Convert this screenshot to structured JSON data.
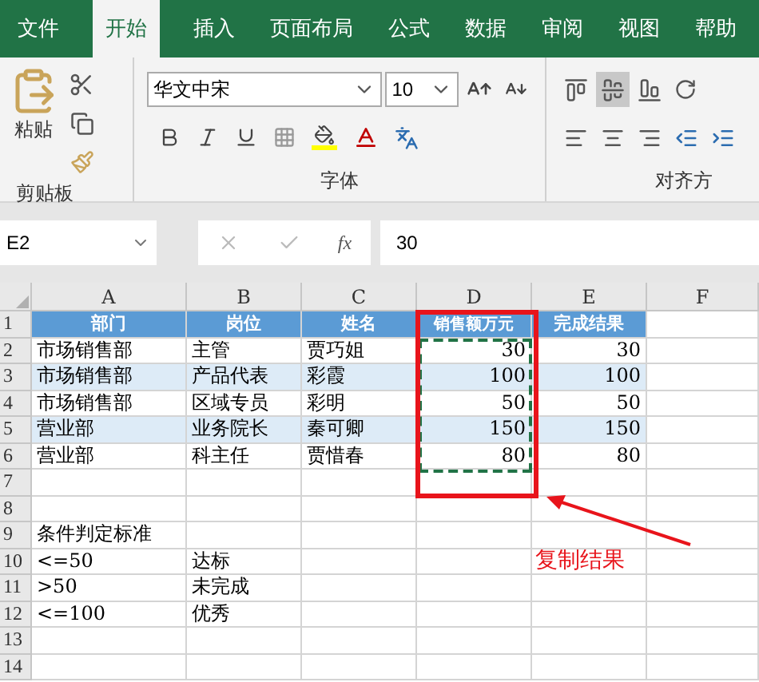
{
  "menu_tabs": [
    {
      "label": "文件",
      "selected": false
    },
    {
      "label": "开始",
      "selected": true
    },
    {
      "label": "插入",
      "selected": false
    },
    {
      "label": "页面布局",
      "selected": false
    },
    {
      "label": "公式",
      "selected": false
    },
    {
      "label": "数据",
      "selected": false
    },
    {
      "label": "审阅",
      "selected": false
    },
    {
      "label": "视图",
      "selected": false
    },
    {
      "label": "帮助",
      "selected": false
    }
  ],
  "ribbon": {
    "clipboard": {
      "paste_label": "粘贴",
      "group_label": "剪贴板"
    },
    "font": {
      "font_name": "华文中宋",
      "font_size": "10",
      "group_label": "字体"
    },
    "alignment": {
      "group_label": "对齐方",
      "vertical_align": [
        {
          "selected": false
        },
        {
          "selected": true
        },
        {
          "selected": false
        }
      ]
    }
  },
  "formula_bar": {
    "name_box": "E2",
    "fx_label": "fx",
    "value": "30"
  },
  "sheet": {
    "columns": [
      "A",
      "B",
      "C",
      "D",
      "E",
      "F"
    ],
    "rows": [
      {
        "number": "1",
        "kind": "header",
        "cells": {
          "A": "部门",
          "B": "岗位",
          "C": "姓名",
          "D": "销售额万元",
          "E": "完成结果"
        }
      },
      {
        "number": "2",
        "kind": "plain",
        "cells": {
          "A": "市场销售部",
          "B": "主管",
          "C": "贾巧姐",
          "D": "30",
          "E": "30"
        }
      },
      {
        "number": "3",
        "kind": "band",
        "cells": {
          "A": "市场销售部",
          "B": "产品代表",
          "C": "彩霞",
          "D": "100",
          "E": "100"
        }
      },
      {
        "number": "4",
        "kind": "plain",
        "cells": {
          "A": "市场销售部",
          "B": "区域专员",
          "C": "彩明",
          "D": "50",
          "E": "50"
        }
      },
      {
        "number": "5",
        "kind": "band",
        "cells": {
          "A": "营业部",
          "B": "业务院长",
          "C": "秦可卿",
          "D": "150",
          "E": "150"
        }
      },
      {
        "number": "6",
        "kind": "plain",
        "cells": {
          "A": "营业部",
          "B": "科主任",
          "C": "贾惜春",
          "D": "80",
          "E": "80"
        }
      },
      {
        "number": "7",
        "kind": "empty",
        "cells": {}
      },
      {
        "number": "8",
        "kind": "empty",
        "cells": {}
      },
      {
        "number": "9",
        "kind": "empty",
        "cells": {
          "A": "条件判定标准"
        }
      },
      {
        "number": "10",
        "kind": "empty",
        "cells": {
          "A": "<=50",
          "B": "达标"
        }
      },
      {
        "number": "11",
        "kind": "empty",
        "cells": {
          "A": ">50",
          "B": "未完成"
        }
      },
      {
        "number": "12",
        "kind": "empty",
        "cells": {
          "A": "<=100",
          "B": "优秀"
        }
      },
      {
        "number": "13",
        "kind": "empty",
        "cells": {}
      },
      {
        "number": "14",
        "kind": "empty",
        "cells": {}
      }
    ]
  },
  "annotation": {
    "label": "复制结果"
  }
}
